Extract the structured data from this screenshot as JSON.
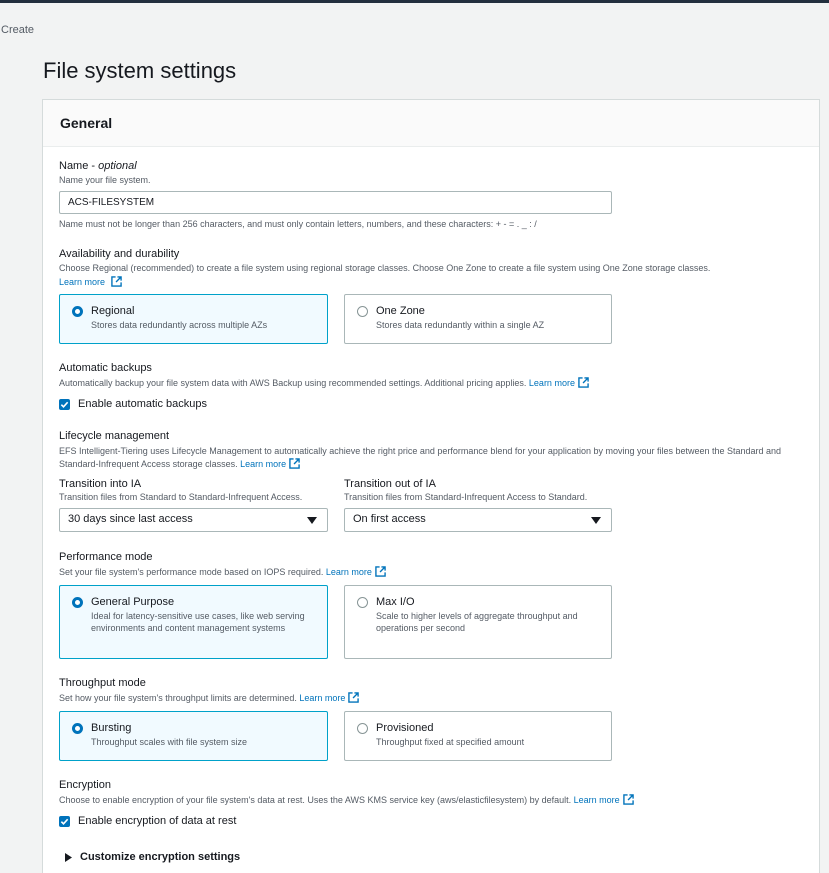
{
  "breadcrumb": "Create",
  "page_title": "File system settings",
  "panel_title": "General",
  "name": {
    "label": "Name",
    "optional": "optional",
    "desc": "Name your file system.",
    "value": "ACS-FILESYSTEM",
    "constraint": "Name must not be longer than 256 characters, and must only contain letters, numbers, and these characters: + - = . _ : /"
  },
  "availability": {
    "label": "Availability and durability",
    "desc": "Choose Regional (recommended) to create a file system using regional storage classes. Choose One Zone to create a file system using One Zone storage classes.",
    "learn_more": "Learn more",
    "options": [
      {
        "title": "Regional",
        "desc": "Stores data redundantly across multiple AZs",
        "selected": true
      },
      {
        "title": "One Zone",
        "desc": "Stores data redundantly within a single AZ",
        "selected": false
      }
    ]
  },
  "backups": {
    "label": "Automatic backups",
    "desc": "Automatically backup your file system data with AWS Backup using recommended settings. Additional pricing applies.",
    "learn_more": "Learn more",
    "checkbox": "Enable automatic backups",
    "checked": true
  },
  "lifecycle": {
    "label": "Lifecycle management",
    "desc": "EFS Intelligent-Tiering uses Lifecycle Management to automatically achieve the right price and performance blend for your application by moving your files between the Standard and Standard-Infrequent Access storage classes.",
    "learn_more": "Learn more",
    "into_ia": {
      "label": "Transition into IA",
      "desc": "Transition files from Standard to Standard-Infrequent Access.",
      "value": "30 days since last access"
    },
    "out_ia": {
      "label": "Transition out of IA",
      "desc": "Transition files from Standard-Infrequent Access to Standard.",
      "value": "On first access"
    }
  },
  "performance": {
    "label": "Performance mode",
    "desc": "Set your file system's performance mode based on IOPS required.",
    "learn_more": "Learn more",
    "options": [
      {
        "title": "General Purpose",
        "desc": "Ideal for latency-sensitive use cases, like web serving environments and content management systems",
        "selected": true
      },
      {
        "title": "Max I/O",
        "desc": "Scale to higher levels of aggregate throughput and operations per second",
        "selected": false
      }
    ]
  },
  "throughput": {
    "label": "Throughput mode",
    "desc": "Set how your file system's throughput limits are determined.",
    "learn_more": "Learn more",
    "options": [
      {
        "title": "Bursting",
        "desc": "Throughput scales with file system size",
        "selected": true
      },
      {
        "title": "Provisioned",
        "desc": "Throughput fixed at specified amount",
        "selected": false
      }
    ]
  },
  "encryption": {
    "label": "Encryption",
    "desc": "Choose to enable encryption of your file system's data at rest. Uses the AWS KMS service key (aws/elasticfilesystem) by default.",
    "learn_more": "Learn more",
    "checkbox": "Enable encryption of data at rest",
    "checked": true,
    "customize": "Customize encryption settings"
  },
  "colors": {
    "accent": "#0073bb",
    "selected_border": "#00a1c9",
    "selected_bg": "#f1faff"
  }
}
